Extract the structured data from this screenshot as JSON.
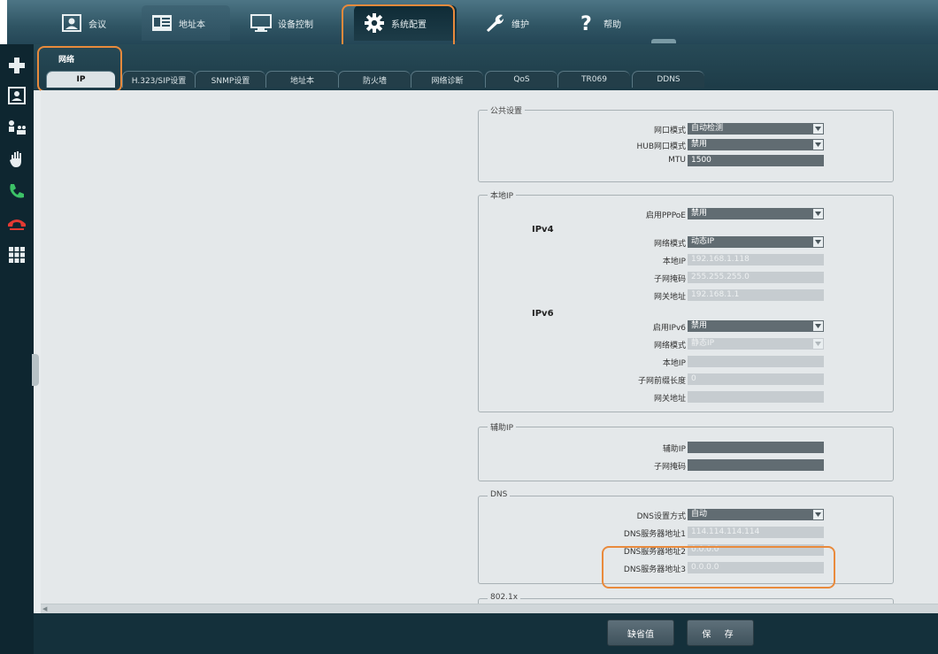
{
  "topnav": {
    "items": [
      {
        "label": "会议",
        "icon": "meeting-icon"
      },
      {
        "label": "地址本",
        "icon": "address-book-icon"
      },
      {
        "label": "设备控制",
        "icon": "monitor-icon"
      },
      {
        "label": "系统配置",
        "icon": "gear-icon"
      },
      {
        "label": "维护",
        "icon": "wrench-icon"
      },
      {
        "label": "帮助",
        "icon": "help-icon"
      }
    ]
  },
  "sidebar": {
    "icons": [
      "plus-icon",
      "contact-icon",
      "conference-users-icon",
      "hand-icon",
      "call-icon",
      "hangup-icon",
      "keypad-icon"
    ]
  },
  "subnav": {
    "title": "网络",
    "tabs": [
      "IP",
      "H.323/SIP设置",
      "SNMP设置",
      "地址本",
      "防火墙",
      "网络诊断",
      "QoS",
      "TR069",
      "DDNS"
    ],
    "active_tab": "IP"
  },
  "groups": {
    "public": {
      "title": "公共设置",
      "rows": [
        {
          "label": "网口模式",
          "value": "自动检测"
        },
        {
          "label": "HUB网口模式",
          "value": "禁用"
        },
        {
          "label": "MTU",
          "value": "1500"
        }
      ]
    },
    "local_ip": {
      "title": "本地IP",
      "pppoe": {
        "label": "启用PPPoE",
        "value": "禁用"
      },
      "ipv4_heading": "IPv4",
      "ipv4_rows": [
        {
          "label": "网络模式",
          "value": "动态IP"
        },
        {
          "label": "本地IP",
          "value": "192.168.1.118"
        },
        {
          "label": "子网掩码",
          "value": "255.255.255.0"
        },
        {
          "label": "网关地址",
          "value": "192.168.1.1"
        }
      ],
      "ipv6_heading": "IPv6",
      "ipv6_rows": [
        {
          "label": "启用IPv6",
          "value": "禁用"
        },
        {
          "label": "网络模式",
          "value": "静态IP"
        },
        {
          "label": "本地IP",
          "value": ""
        },
        {
          "label": "子网前缀长度",
          "value": "0"
        },
        {
          "label": "网关地址",
          "value": ""
        }
      ]
    },
    "aux_ip": {
      "title": "辅助IP",
      "rows": [
        {
          "label": "辅助IP",
          "value": ""
        },
        {
          "label": "子网掩码",
          "value": ""
        }
      ]
    },
    "dns": {
      "title": "DNS",
      "rows": [
        {
          "label": "DNS设置方式",
          "value": "自动"
        },
        {
          "label": "DNS服务器地址1",
          "value": "114.114.114.114"
        },
        {
          "label": "DNS服务器地址2",
          "value": "0.0.0.0"
        },
        {
          "label": "DNS服务器地址3",
          "value": "0.0.0.0"
        }
      ]
    },
    "dot1x": {
      "title": "802.1x"
    }
  },
  "footer": {
    "default_label": "缺省值",
    "save_label": "保 存"
  },
  "colors": {
    "highlight": "#e98a3c",
    "field_dark": "#616c72",
    "field_disabled": "#c6ccd0"
  }
}
